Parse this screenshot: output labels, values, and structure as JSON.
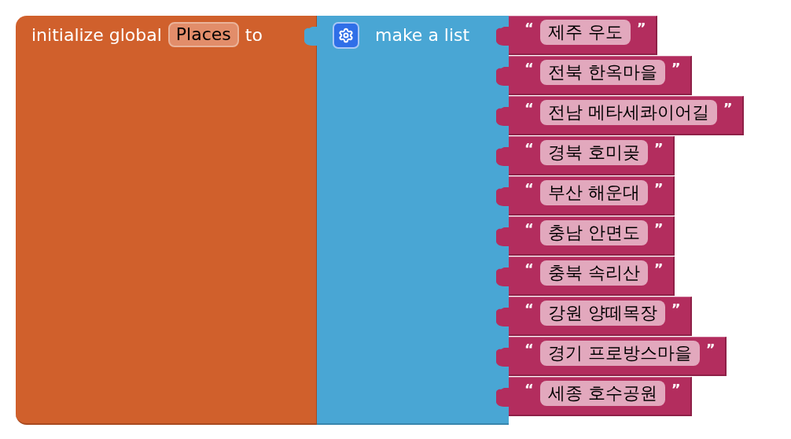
{
  "init_block": {
    "label": "initialize global",
    "variable_name": "Places",
    "to_label": "to"
  },
  "list_block": {
    "label": "make a list"
  },
  "items": [
    {
      "open": "“",
      "text": "제주 우도",
      "close": "”"
    },
    {
      "open": "“",
      "text": "전북 한옥마을",
      "close": "”"
    },
    {
      "open": "“",
      "text": "전남 메타세콰이어길",
      "close": "”"
    },
    {
      "open": "“",
      "text": "경북 호미곶",
      "close": "”"
    },
    {
      "open": "“",
      "text": "부산 해운대",
      "close": "”"
    },
    {
      "open": "“",
      "text": "충남 안면도",
      "close": "”"
    },
    {
      "open": "“",
      "text": "충북 속리산",
      "close": "”"
    },
    {
      "open": "“",
      "text": "강원 양떼목장",
      "close": "”"
    },
    {
      "open": "“",
      "text": "경기 프로방스마을",
      "close": "”"
    },
    {
      "open": "“",
      "text": "세종 호수공원",
      "close": "”"
    }
  ]
}
